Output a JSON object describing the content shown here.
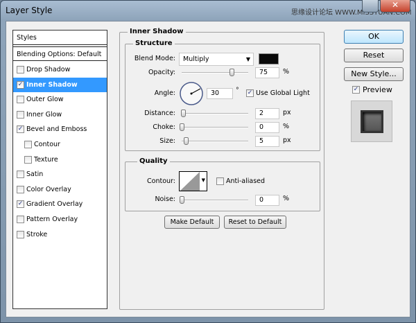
{
  "window": {
    "title": "Layer Style",
    "watermark": "思缘设计论坛 WWW.MISSYUAN.COM"
  },
  "sidebar": {
    "header": "Styles",
    "blending": "Blending Options: Default",
    "items": [
      {
        "label": "Drop Shadow",
        "checked": false
      },
      {
        "label": "Inner Shadow",
        "checked": true,
        "selected": true
      },
      {
        "label": "Outer Glow",
        "checked": false
      },
      {
        "label": "Inner Glow",
        "checked": false
      },
      {
        "label": "Bevel and Emboss",
        "checked": true
      },
      {
        "label": "Contour",
        "checked": false,
        "indent": true
      },
      {
        "label": "Texture",
        "checked": false,
        "indent": true
      },
      {
        "label": "Satin",
        "checked": false
      },
      {
        "label": "Color Overlay",
        "checked": false
      },
      {
        "label": "Gradient Overlay",
        "checked": true
      },
      {
        "label": "Pattern Overlay",
        "checked": false
      },
      {
        "label": "Stroke",
        "checked": false
      }
    ]
  },
  "panel": {
    "title": "Inner Shadow",
    "structure": {
      "title": "Structure",
      "blend_mode_label": "Blend Mode:",
      "blend_mode": "Multiply",
      "color": "#0a0a0a",
      "opacity_label": "Opacity:",
      "opacity": "75",
      "opacity_unit": "%",
      "angle_label": "Angle:",
      "angle": "30",
      "angle_unit": "°",
      "global_light": "Use Global Light",
      "global_light_checked": true,
      "distance_label": "Distance:",
      "distance": "2",
      "distance_unit": "px",
      "choke_label": "Choke:",
      "choke": "0",
      "choke_unit": "%",
      "size_label": "Size:",
      "size": "5",
      "size_unit": "px"
    },
    "quality": {
      "title": "Quality",
      "contour_label": "Contour:",
      "anti_aliased": "Anti-aliased",
      "anti_aliased_checked": false,
      "noise_label": "Noise:",
      "noise": "0",
      "noise_unit": "%"
    },
    "make_default": "Make Default",
    "reset_default": "Reset to Default"
  },
  "actions": {
    "ok": "OK",
    "reset": "Reset",
    "new_style": "New Style...",
    "preview": "Preview",
    "preview_checked": true
  }
}
